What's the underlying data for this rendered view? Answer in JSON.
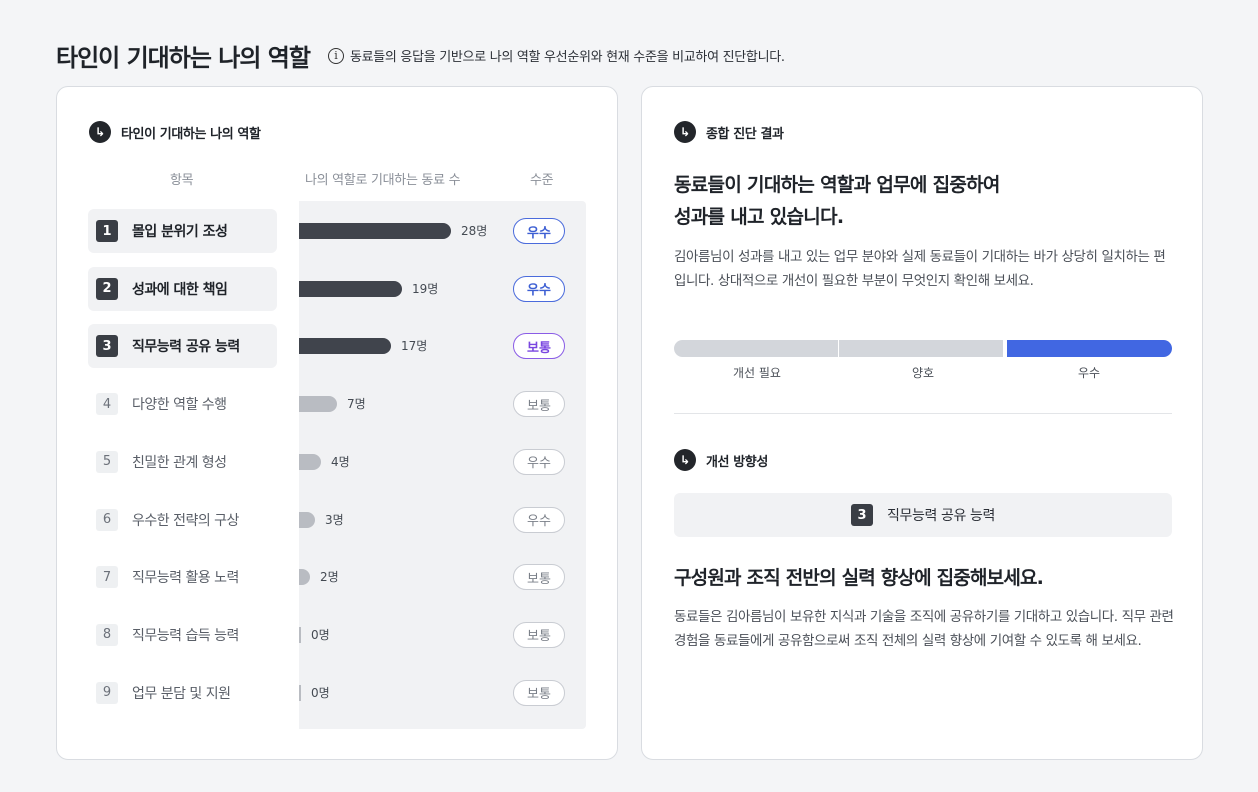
{
  "header": {
    "title": "타인이 기대하는 나의 역할",
    "info_icon": "info-icon",
    "info_text": "동료들의 응답을 기반으로 나의 역할 우선순위와 현재 수준을 비교하여 진단합니다."
  },
  "left": {
    "section_title": "타인이 기대하는 나의 역할",
    "columns": {
      "item": "항목",
      "count": "나의 역할로 기대하는 동료 수",
      "level": "수준"
    },
    "rows": [
      {
        "num": "1",
        "label": "몰입 분위기 조성",
        "count": 28,
        "count_text": "28명",
        "level": "우수",
        "level_type": "great",
        "top": true
      },
      {
        "num": "2",
        "label": "성과에 대한 책임",
        "count": 19,
        "count_text": "19명",
        "level": "우수",
        "level_type": "great",
        "top": true
      },
      {
        "num": "3",
        "label": "직무능력 공유 능력",
        "count": 17,
        "count_text": "17명",
        "level": "보통",
        "level_type": "normal",
        "top": true
      },
      {
        "num": "4",
        "label": "다양한 역할 수행",
        "count": 7,
        "count_text": "7명",
        "level": "보통",
        "level_type": "muted",
        "top": false
      },
      {
        "num": "5",
        "label": "친밀한 관계 형성",
        "count": 4,
        "count_text": "4명",
        "level": "우수",
        "level_type": "muted",
        "top": false
      },
      {
        "num": "6",
        "label": "우수한 전략의 구상",
        "count": 3,
        "count_text": "3명",
        "level": "우수",
        "level_type": "muted",
        "top": false
      },
      {
        "num": "7",
        "label": "직무능력 활용 노력",
        "count": 2,
        "count_text": "2명",
        "level": "보통",
        "level_type": "muted",
        "top": false
      },
      {
        "num": "8",
        "label": "직무능력 습득 능력",
        "count": 0,
        "count_text": "0명",
        "level": "보통",
        "level_type": "muted",
        "top": false
      },
      {
        "num": "9",
        "label": "업무 분담 및 지원",
        "count": 0,
        "count_text": "0명",
        "level": "보통",
        "level_type": "muted",
        "top": false
      }
    ]
  },
  "right": {
    "section_title": "종합 진단 결과",
    "headline_line1": "동료들이 기대하는 역할과 업무에 집중하여",
    "headline_line2": "성과를 내고 있습니다.",
    "description": "김아름님이 성과를 내고 있는 업무 분야와 실제 동료들이 기대하는 바가 상당히 일치하는 편입니다. 상대적으로 개선이 필요한 부분이 무엇인지 확인해 보세요.",
    "scale_labels": [
      "개선 필요",
      "양호",
      "우수"
    ],
    "scale_active": "우수",
    "colors": {
      "active": "#4167e2",
      "inactive": "#d3d6db"
    },
    "improve_title": "개선 방향성",
    "improve_num": "3",
    "improve_label": "직무능력 공유 능력",
    "improve_headline": "구성원과 조직 전반의 실력 향상에 집중해보세요.",
    "improve_desc": "동료들은 김아름님이 보유한 지식과 기술을 조직에 공유하기를 기대하고 있습니다. 직무 관련 경험을 동료들에게 공유함으로써 조직 전체의 실력 향상에 기여할 수 있도록 해 보세요."
  }
}
